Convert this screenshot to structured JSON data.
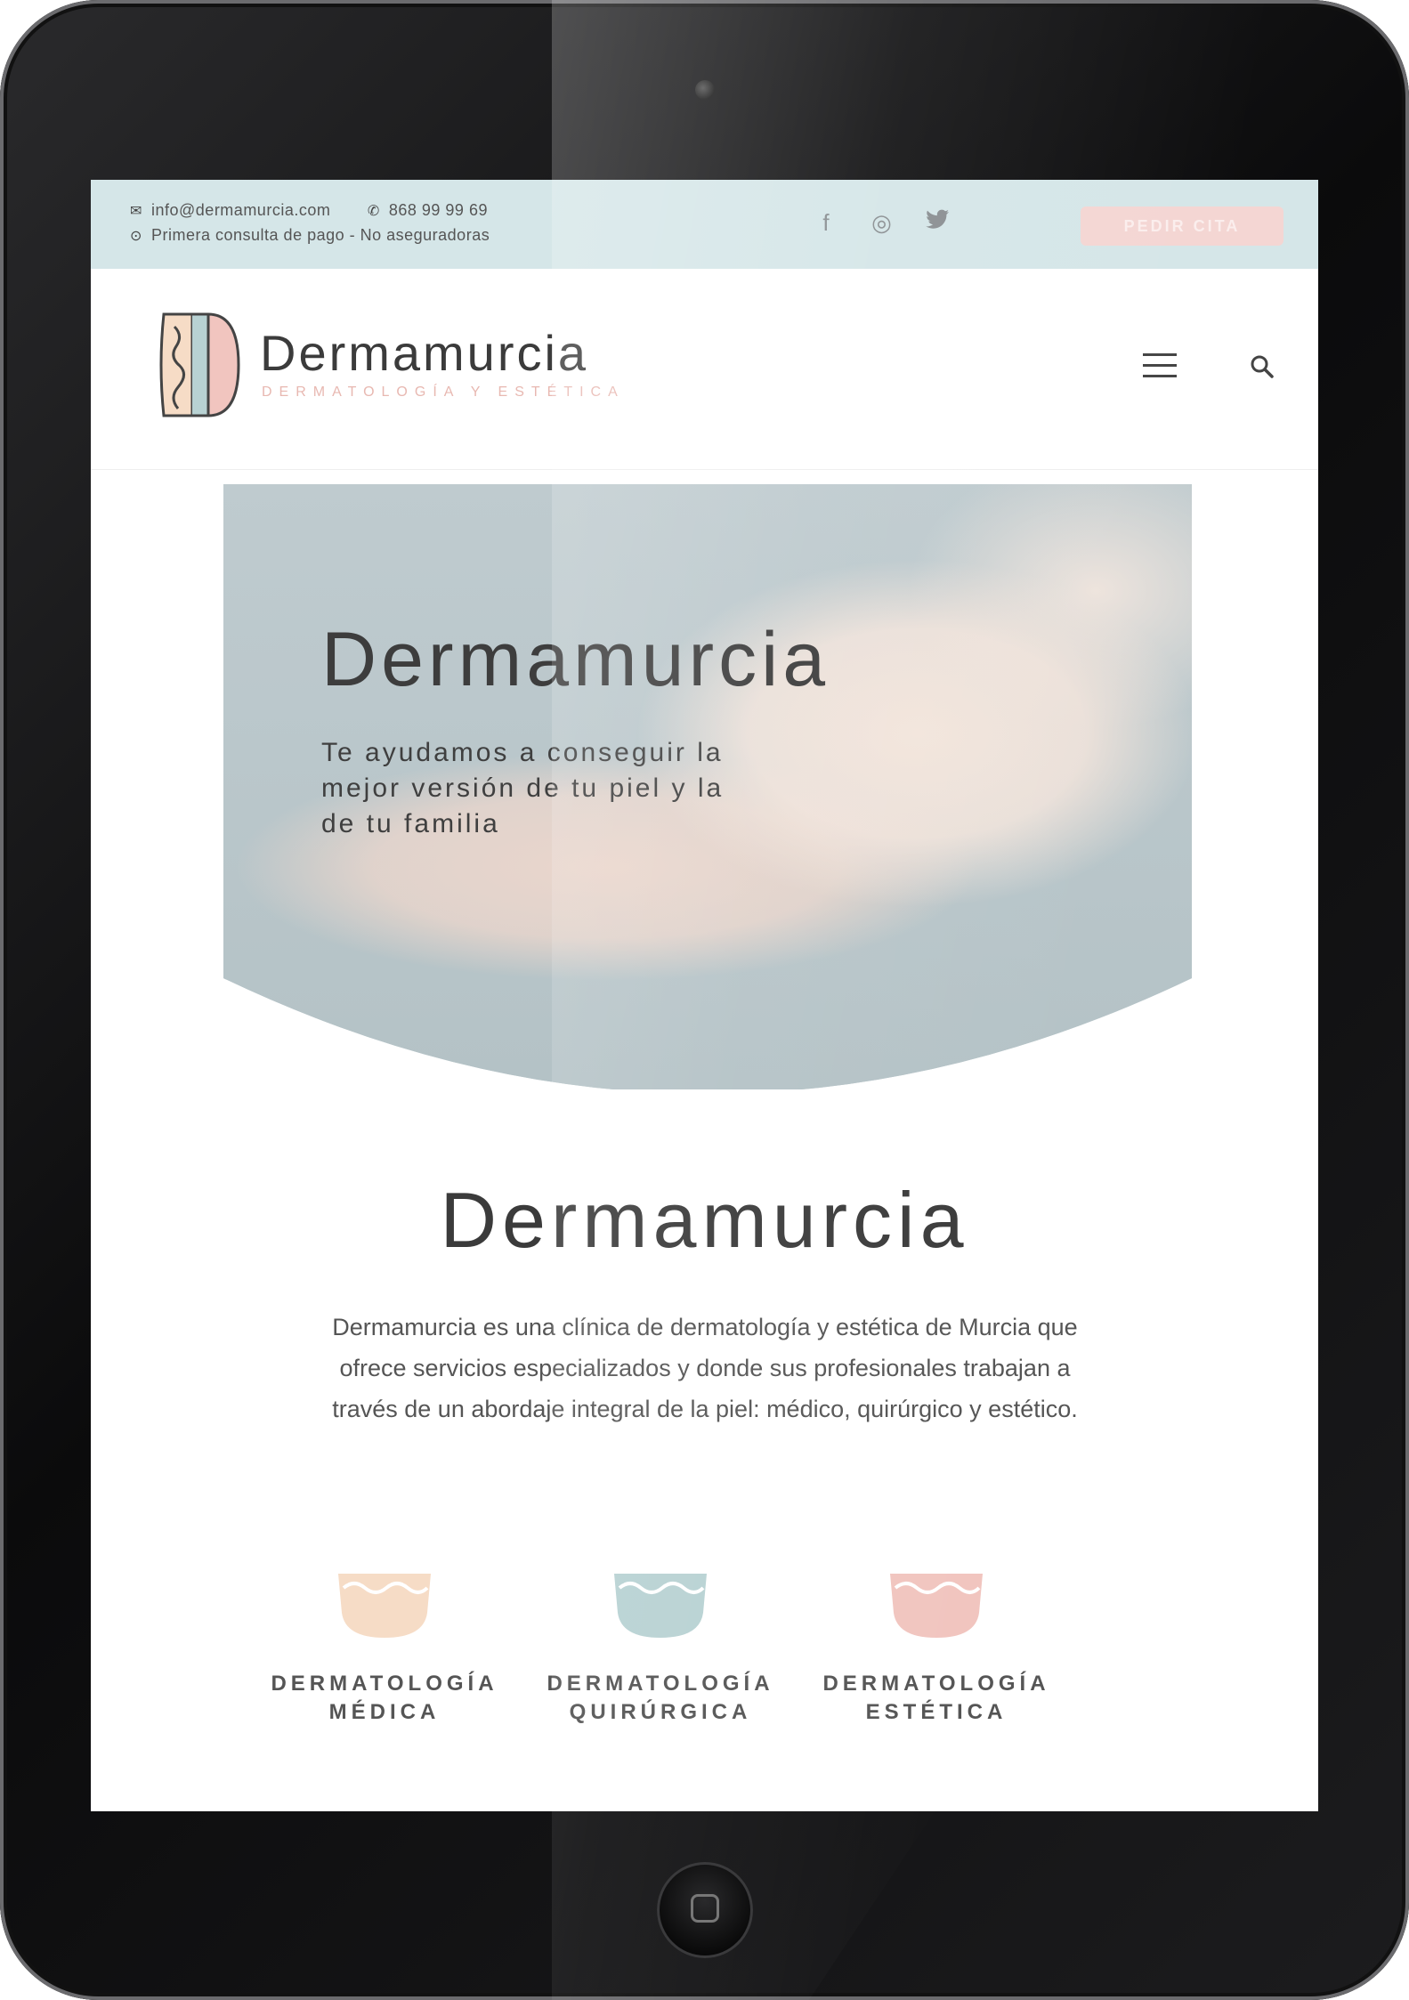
{
  "topbar": {
    "email": "info@dermamurcia.com",
    "phone": "868 99 99 69",
    "notice": "Primera consulta de pago - No aseguradoras",
    "cta_label": "PEDIR CITA",
    "socials": [
      {
        "icon": "facebook-icon",
        "glyph": "f"
      },
      {
        "icon": "instagram-icon",
        "glyph": "◎"
      },
      {
        "icon": "twitter-icon",
        "glyph": "🐦"
      }
    ]
  },
  "header": {
    "brand": "Dermamurcia",
    "tagline": "DERMATOLOGÍA Y ESTÉTICA"
  },
  "hero": {
    "title": "Dermamurcia",
    "text": "Te ayudamos a conseguir la mejor versión de tu piel y la de tu familia"
  },
  "intro": {
    "title": "Dermamurcia",
    "text": "Dermamurcia es una clínica de dermatología y estética de Murcia que ofrece servicios especializados y donde sus profesionales trabajan a través de un abordaje integral de la piel: médico, quirúrgico y estético."
  },
  "services": [
    {
      "line1": "DERMATOLOGÍA",
      "line2": "MÉDICA",
      "color": "#f6dcc6"
    },
    {
      "line1": "DERMATOLOGÍA",
      "line2": "QUIRÚRGICA",
      "color": "#b8d2d3"
    },
    {
      "line1": "DERMATOLOGÍA",
      "line2": "ESTÉTICA",
      "color": "#f1c5bf"
    }
  ],
  "colors": {
    "topbar_bg": "#d5e6e8",
    "cta_bg": "#f4d6d3",
    "text_dark": "#3b3b3b"
  }
}
